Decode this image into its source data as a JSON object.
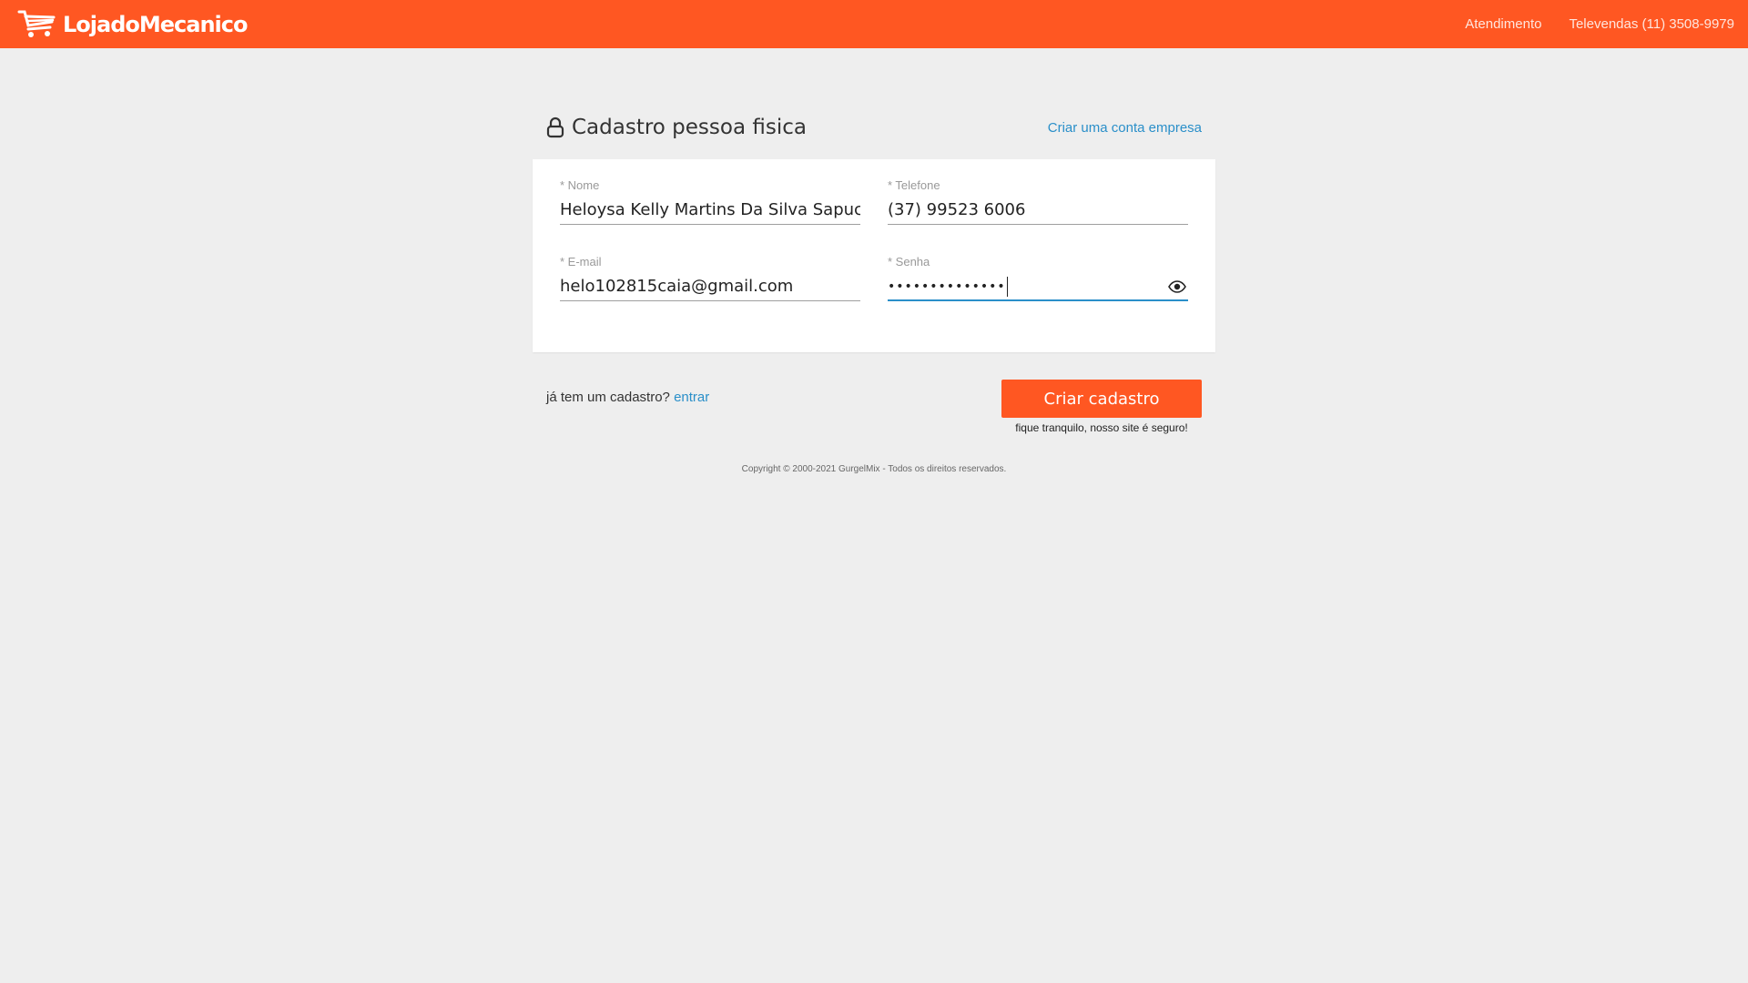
{
  "header": {
    "brand": "LojadoMecanico",
    "nav": [
      {
        "label": "Atendimento"
      },
      {
        "label": "Televendas (11) 3508-9979"
      }
    ],
    "color": "#ff5722"
  },
  "page": {
    "title": "Cadastro pessoa fisica",
    "title_icon": "lock-icon",
    "business_link": "Criar uma conta empresa"
  },
  "form": {
    "name": {
      "label": "* Nome",
      "value": "Heloysa Kelly Martins Da Silva Sapucaia"
    },
    "phone": {
      "label": "* Telefone",
      "value": "(37) 99523 6006"
    },
    "email": {
      "label": "* E-mail",
      "value": "helo102815caia@gmail.com"
    },
    "password": {
      "label": "* Senha",
      "value": "••••••••••••••",
      "toggle_icon": "eye-icon"
    }
  },
  "actions": {
    "login_prompt": "já tem um cadastro?",
    "login_link": "entrar",
    "submit": "Criar cadastro",
    "secure_note": "fique tranquilo, nosso site é seguro!"
  },
  "footer": {
    "copyright": "Copyright © 2000-2021 GurgelMix - Todos os direitos reservados."
  },
  "colors": {
    "accent": "#ff5722",
    "link": "#2a8fc9",
    "background": "#eeeeee"
  }
}
